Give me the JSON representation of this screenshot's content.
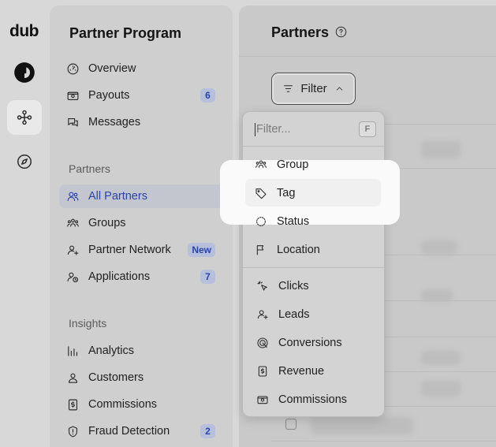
{
  "brand": "dub",
  "sidebar": {
    "title": "Partner Program",
    "top_items": [
      {
        "label": "Overview"
      },
      {
        "label": "Payouts",
        "badge": "6"
      },
      {
        "label": "Messages"
      }
    ],
    "partners_section": "Partners",
    "partner_items": [
      {
        "label": "All Partners"
      },
      {
        "label": "Groups"
      },
      {
        "label": "Partner Network",
        "badge": "New"
      },
      {
        "label": "Applications",
        "badge": "7"
      }
    ],
    "insights_section": "Insights",
    "insight_items": [
      {
        "label": "Analytics"
      },
      {
        "label": "Customers"
      },
      {
        "label": "Commissions"
      },
      {
        "label": "Fraud Detection",
        "badge": "2"
      }
    ]
  },
  "main": {
    "title": "Partners",
    "filter_label": "Filter"
  },
  "dropdown": {
    "search_placeholder": "Filter...",
    "shortcut": "F",
    "group1": [
      {
        "label": "Group",
        "icon": "users-icon"
      },
      {
        "label": "Tag",
        "icon": "tag-icon"
      },
      {
        "label": "Status",
        "icon": "status-icon"
      },
      {
        "label": "Location",
        "icon": "flag-icon"
      }
    ],
    "group2": [
      {
        "label": "Clicks",
        "icon": "cursor-click-icon"
      },
      {
        "label": "Leads",
        "icon": "user-plus-icon"
      },
      {
        "label": "Conversions",
        "icon": "target-icon"
      },
      {
        "label": "Revenue",
        "icon": "invoice-dollar-icon"
      },
      {
        "label": "Commissions",
        "icon": "money-bill-icon"
      }
    ]
  },
  "colors": {
    "accent": "#2a44a8",
    "background": "#d8d8d8"
  }
}
